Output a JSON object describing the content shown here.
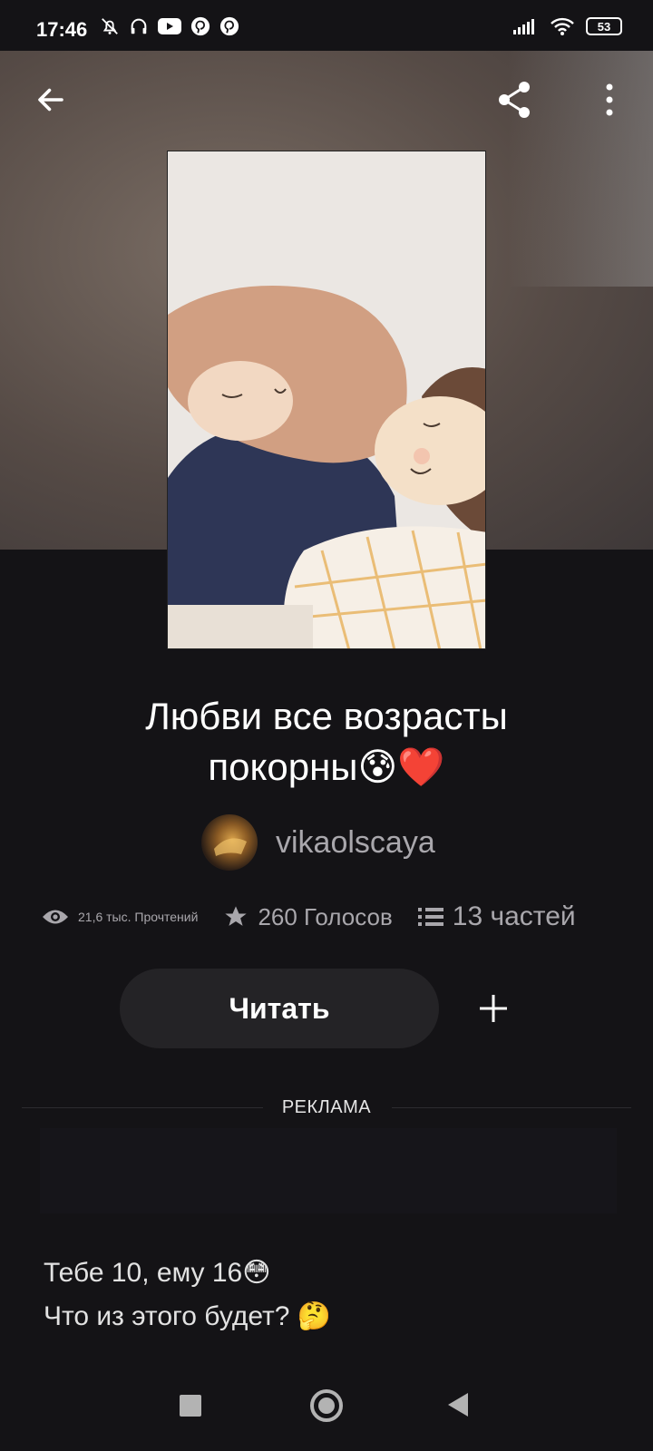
{
  "status_bar": {
    "time": "17:46",
    "battery": "53",
    "left_icons": [
      "muted-bell-icon",
      "headphones-icon",
      "youtube-icon",
      "pinterest-icon",
      "pinterest-icon"
    ],
    "right_icons": [
      "signal-icon",
      "wifi-icon",
      "battery-icon"
    ]
  },
  "toolbar": {
    "back_icon": "arrow-left-icon",
    "share_icon": "share-icon",
    "menu_icon": "more-vertical-icon"
  },
  "story": {
    "title_line1": "Любви все возрасты",
    "title_line2": "покорны😰❤️",
    "author": "vikaolscaya",
    "stats": {
      "reads": "21,6 тыс. Прочтений",
      "votes": "260 Голосов",
      "parts": "13 частей"
    },
    "read_button": "Читать",
    "description_line1": "Тебе 10, ему 16😳",
    "description_line2": "Что из этого будет? 🤔"
  },
  "ad": {
    "label": "РЕКЛАМА"
  },
  "colors": {
    "background": "#141316",
    "button_bg": "#242326",
    "muted_text": "#a9a7ac"
  }
}
